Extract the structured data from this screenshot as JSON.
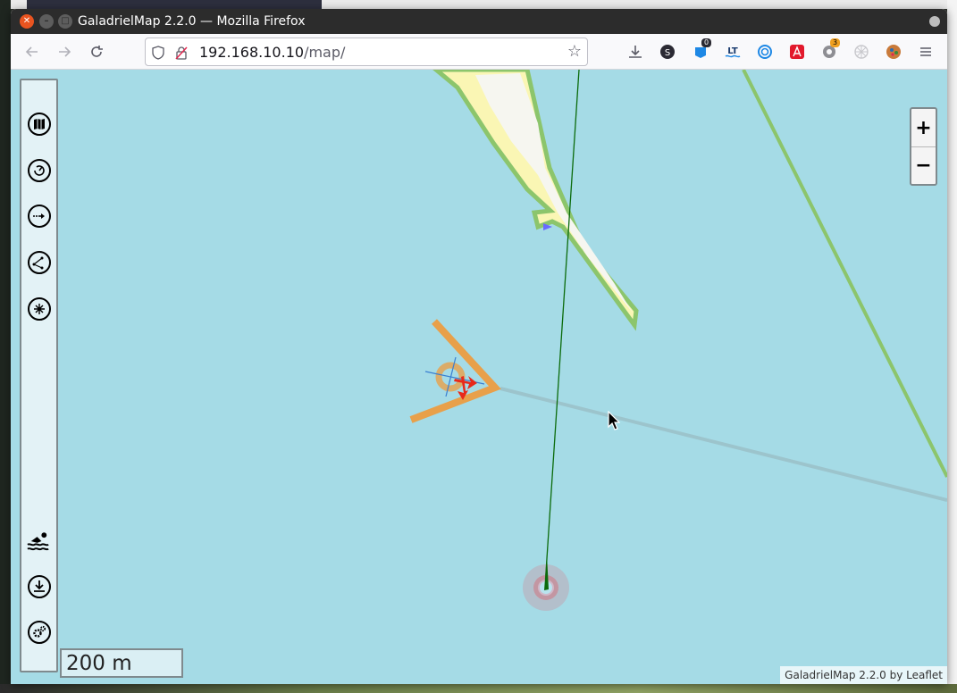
{
  "window": {
    "title": "GaladrielMap 2.2.0 — Mozilla Firefox"
  },
  "browser": {
    "url_host": "192.168.10.10",
    "url_path": "/map/",
    "toolbar_icons": [
      "download-icon",
      "s-extension-icon",
      "extension-badge-icon",
      "languagetool-icon",
      "sync-icon",
      "adobe-icon",
      "ublock-icon",
      "extension-grid-icon",
      "profile-icon",
      "menu-icon"
    ],
    "badges": {
      "extension_badge": "0",
      "ublock_badge": "3"
    }
  },
  "sidebar": {
    "items": [
      {
        "name": "maps-icon"
      },
      {
        "name": "dashboard-icon"
      },
      {
        "name": "route-icon"
      },
      {
        "name": "tracks-icon"
      },
      {
        "name": "points-icon"
      },
      {
        "name": "swimmer-icon"
      },
      {
        "name": "download-icon"
      },
      {
        "name": "settings-icon"
      }
    ]
  },
  "zoom": {
    "in_label": "+",
    "out_label": "−"
  },
  "scale": {
    "label": "200 m"
  },
  "attribution": {
    "text": "GaladrielMap 2.2.0 by Leaflet"
  },
  "colors": {
    "water": "#a5dbe6",
    "land_border": "#8cc56c",
    "sand": "#faf6b4",
    "track": "#1a6b1a",
    "anchor_orange": "#e8a04a",
    "vector_red": "#e8291b",
    "sidebar_bg": "#e3f2f6"
  }
}
